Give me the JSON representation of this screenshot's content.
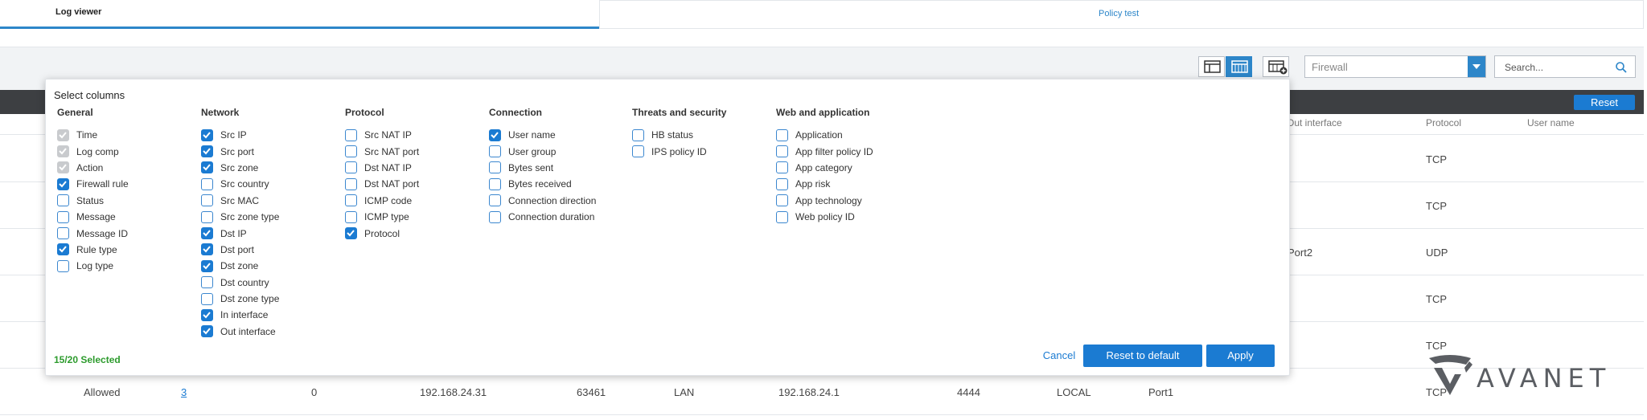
{
  "tabs": [
    {
      "label": "Log viewer",
      "active": true
    },
    {
      "label": "Policy test",
      "active": false
    }
  ],
  "toolbar": {
    "log_select_value": "Firewall",
    "search_placeholder": "Search..."
  },
  "table": {
    "reset_label": "Reset",
    "visible_headers": [
      "Out interface",
      "Protocol",
      "User name"
    ],
    "rows": [
      {
        "protocol": "TCP"
      },
      {
        "protocol": "TCP"
      },
      {
        "out_interface": "Port2",
        "protocol": "UDP"
      },
      {
        "protocol": "TCP"
      },
      {
        "protocol": "TCP"
      },
      {
        "action": "Allowed",
        "rule": "3",
        "rule_type": "0",
        "src_ip": "192.168.24.31",
        "src_port": "63461",
        "src_zone": "LAN",
        "dst_ip": "192.168.24.1",
        "dst_port": "4444",
        "dst_zone": "LOCAL",
        "in_interface": "Port1",
        "protocol": "TCP"
      }
    ]
  },
  "modal": {
    "title": "Select columns",
    "groups": [
      {
        "title": "General",
        "options": [
          {
            "label": "Time",
            "state": "disabled"
          },
          {
            "label": "Log comp",
            "state": "disabled"
          },
          {
            "label": "Action",
            "state": "disabled"
          },
          {
            "label": "Firewall rule",
            "state": "checked"
          },
          {
            "label": "Status",
            "state": "unchecked"
          },
          {
            "label": "Message",
            "state": "unchecked"
          },
          {
            "label": "Message ID",
            "state": "unchecked"
          },
          {
            "label": "Rule type",
            "state": "checked"
          },
          {
            "label": "Log type",
            "state": "unchecked"
          }
        ]
      },
      {
        "title": "Network",
        "options": [
          {
            "label": "Src IP",
            "state": "checked"
          },
          {
            "label": "Src port",
            "state": "checked"
          },
          {
            "label": "Src zone",
            "state": "checked"
          },
          {
            "label": "Src country",
            "state": "unchecked"
          },
          {
            "label": "Src MAC",
            "state": "unchecked"
          },
          {
            "label": "Src zone type",
            "state": "unchecked"
          },
          {
            "label": "Dst IP",
            "state": "checked"
          },
          {
            "label": "Dst port",
            "state": "checked"
          },
          {
            "label": "Dst zone",
            "state": "checked"
          },
          {
            "label": "Dst country",
            "state": "unchecked"
          },
          {
            "label": "Dst zone type",
            "state": "unchecked"
          },
          {
            "label": "In interface",
            "state": "checked"
          },
          {
            "label": "Out interface",
            "state": "checked"
          }
        ]
      },
      {
        "title": "Protocol",
        "options": [
          {
            "label": "Src NAT IP",
            "state": "unchecked"
          },
          {
            "label": "Src NAT port",
            "state": "unchecked"
          },
          {
            "label": "Dst NAT IP",
            "state": "unchecked"
          },
          {
            "label": "Dst NAT port",
            "state": "unchecked"
          },
          {
            "label": "ICMP code",
            "state": "unchecked"
          },
          {
            "label": "ICMP type",
            "state": "unchecked"
          },
          {
            "label": "Protocol",
            "state": "checked"
          }
        ]
      },
      {
        "title": "Connection",
        "options": [
          {
            "label": "User name",
            "state": "checked"
          },
          {
            "label": "User group",
            "state": "unchecked"
          },
          {
            "label": "Bytes sent",
            "state": "unchecked"
          },
          {
            "label": "Bytes received",
            "state": "unchecked"
          },
          {
            "label": "Connection direction",
            "state": "unchecked"
          },
          {
            "label": "Connection duration",
            "state": "unchecked"
          }
        ]
      },
      {
        "title": "Threats and security",
        "options": [
          {
            "label": "HB status",
            "state": "unchecked"
          },
          {
            "label": "IPS policy ID",
            "state": "unchecked"
          }
        ]
      },
      {
        "title": "Web and application",
        "options": [
          {
            "label": "Application",
            "state": "unchecked"
          },
          {
            "label": "App filter policy ID",
            "state": "unchecked"
          },
          {
            "label": "App category",
            "state": "unchecked"
          },
          {
            "label": "App risk",
            "state": "unchecked"
          },
          {
            "label": "App technology",
            "state": "unchecked"
          },
          {
            "label": "Web policy ID",
            "state": "unchecked"
          }
        ]
      }
    ],
    "selected_count": "15/20 Selected",
    "buttons": {
      "cancel": "Cancel",
      "reset_default": "Reset to default",
      "apply": "Apply"
    }
  },
  "logo": {
    "text": "AVANET"
  },
  "colors": {
    "accent": "#1b7bd2",
    "header_bar": "#3d3f42",
    "selected_text": "#2d9b2d"
  }
}
